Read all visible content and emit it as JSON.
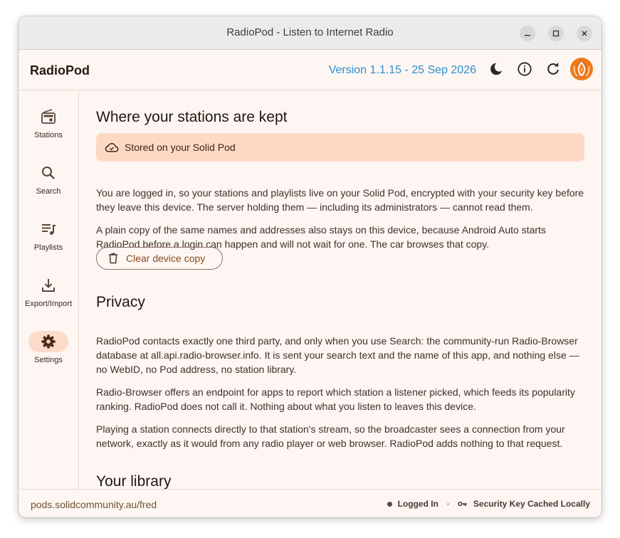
{
  "window": {
    "title": "RadioPod - Listen to Internet Radio"
  },
  "appbar": {
    "app_name": "RadioPod",
    "version": "Version 1.1.15 - 25 Sep 2026",
    "actions": [
      {
        "name": "theme",
        "icon": "moon-icon"
      },
      {
        "name": "info",
        "icon": "info-icon"
      },
      {
        "name": "refresh",
        "icon": "refresh-icon"
      },
      {
        "name": "account",
        "icon": "app-logo-icon"
      }
    ]
  },
  "rail": {
    "items": [
      {
        "label": "Stations",
        "icon": "radio-icon",
        "active": false
      },
      {
        "label": "Search",
        "icon": "search-icon",
        "active": false
      },
      {
        "label": "Playlists",
        "icon": "playlist-icon",
        "active": false
      },
      {
        "label": "Export/Import",
        "icon": "download-icon",
        "active": false
      },
      {
        "label": "Settings",
        "icon": "gear-icon",
        "active": true
      }
    ]
  },
  "content": {
    "storage": {
      "heading": "Where your stations are kept",
      "banner": "Stored on your Solid Pod",
      "para1": "You are logged in, so your stations and playlists live on your Solid Pod, encrypted with your security key before they leave this device. The server holding them — including its administrators — cannot read them.",
      "para2": "A plain copy of the same names and addresses also stays on this device, because Android Auto starts RadioPod before a login can happen and will not wait for one. The car browses that copy.",
      "clear_button": "Clear device copy"
    },
    "privacy": {
      "heading": "Privacy",
      "para1": "RadioPod contacts exactly one third party, and only when you use Search: the community-run Radio-Browser database at all.api.radio-browser.info. It is sent your search text and the name of this app, and nothing else — no WebID, no Pod address, no station library.",
      "para2": "Radio-Browser offers an endpoint for apps to report which station a listener picked, which feeds its popularity ranking. RadioPod does not call it. Nothing about what you listen to leaves this device.",
      "para3": "Playing a station connects directly to that station's stream, so the broadcaster sees a connection from your network, exactly as it would from any radio player or web browser. RadioPod adds nothing to that request."
    },
    "library": {
      "heading": "Your library"
    }
  },
  "statusbar": {
    "pod_url": "pods.solidcommunity.au/fred",
    "login_status": "Logged In",
    "key_status": "Security Key Cached Locally"
  },
  "colors": {
    "accent": "#2f8fd0",
    "banner": "#fdd9c4",
    "rail_active": "#fbdccb",
    "button_text": "#8a4a22"
  }
}
